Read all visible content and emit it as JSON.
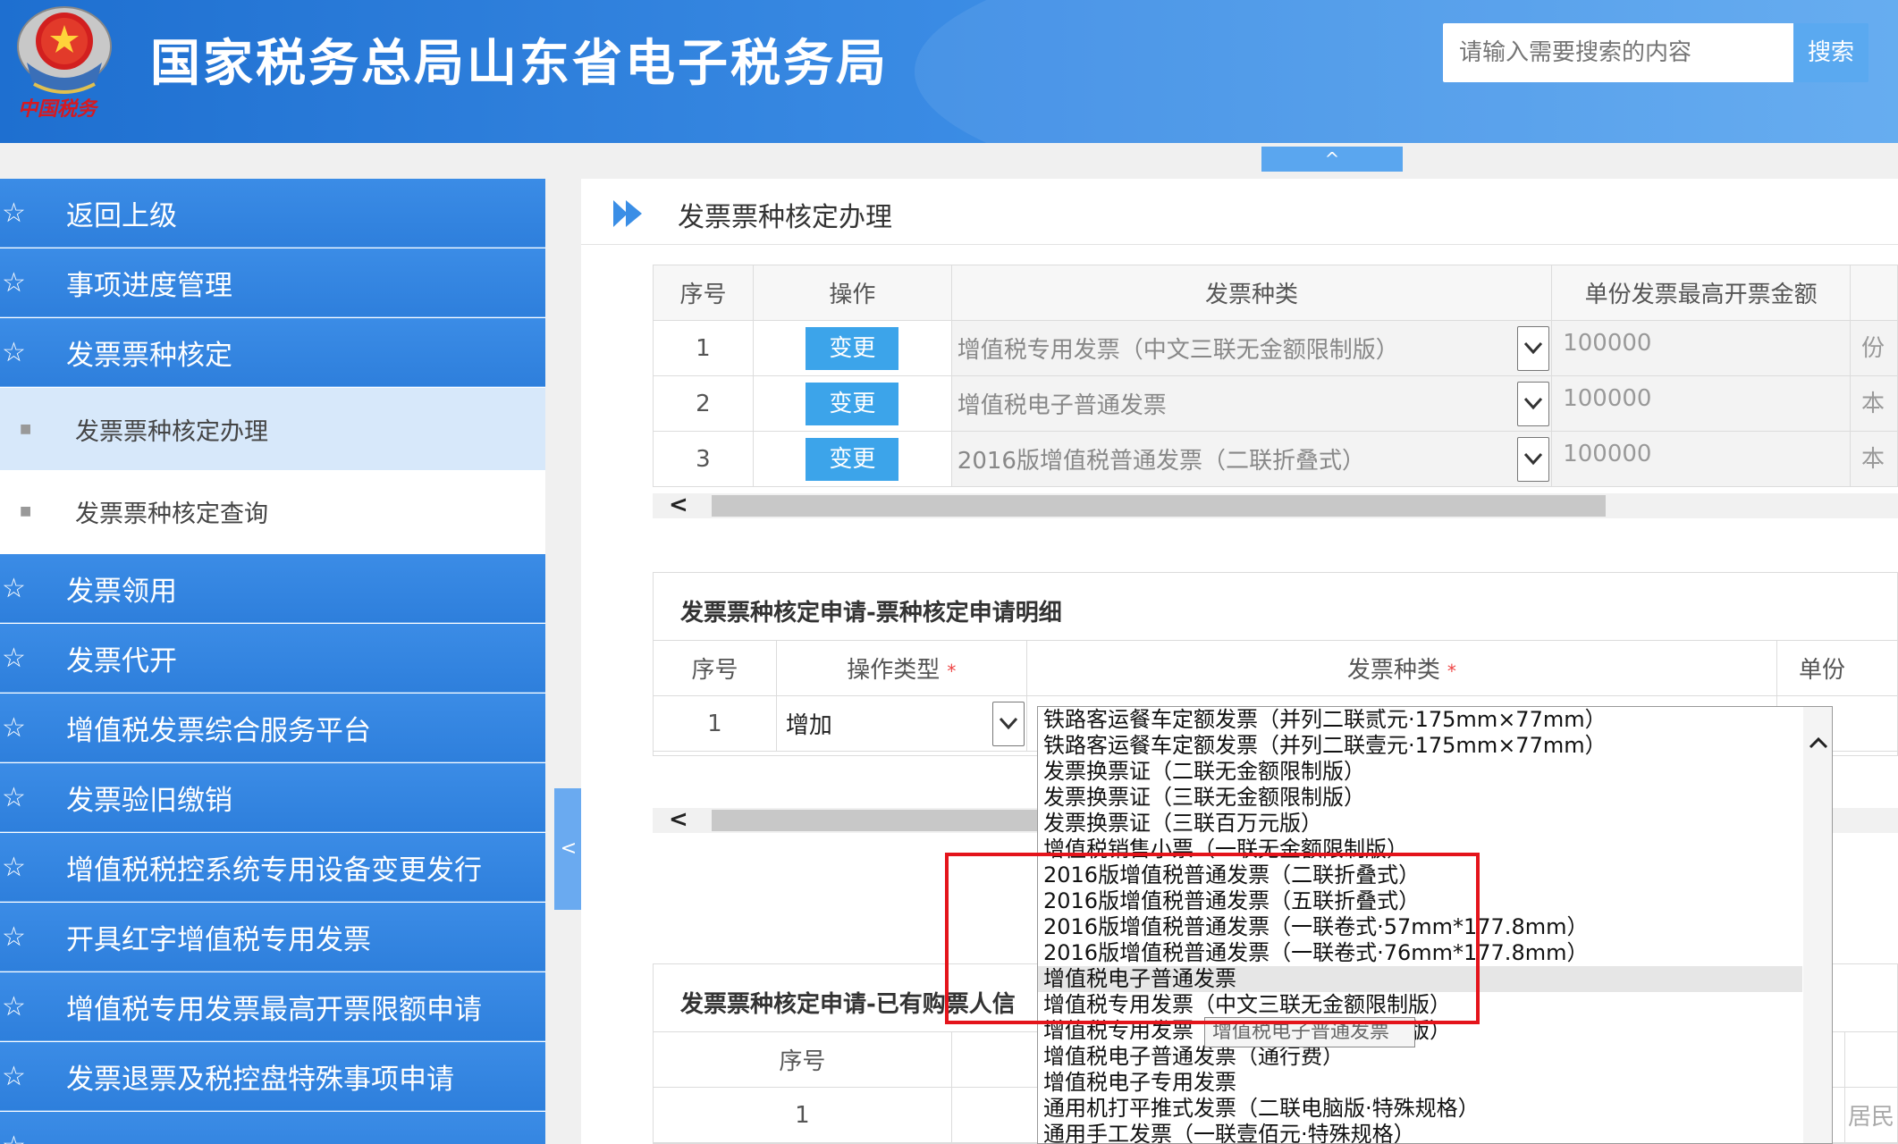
{
  "header": {
    "site_title": "国家税务总局山东省电子税务局",
    "emblem_caption": "中国税务",
    "search_placeholder": "请输入需要搜索的内容",
    "search_button": "搜索",
    "collapse_top": "^"
  },
  "sidebar": {
    "items": [
      {
        "label": "返回上级",
        "icon": "star-outline-icon"
      },
      {
        "label": "事项进度管理",
        "icon": "star-outline-icon"
      },
      {
        "label": "发票票种核定",
        "icon": "star-outline-icon"
      }
    ],
    "sub_items": [
      {
        "label": "发票票种核定办理",
        "active": true
      },
      {
        "label": "发票票种核定查询",
        "active": false
      }
    ],
    "items_after": [
      {
        "label": "发票领用"
      },
      {
        "label": "发票代开"
      },
      {
        "label": "增值税发票综合服务平台"
      },
      {
        "label": "发票验旧缴销"
      },
      {
        "label": "增值税税控系统专用设备变更发行"
      },
      {
        "label": "开具红字增值税专用发票"
      },
      {
        "label": "增值税专用发票最高开票限额申请"
      },
      {
        "label": "发票退票及税控盘特殊事项申请"
      }
    ],
    "toggle": "<"
  },
  "main": {
    "page_title": "发票票种核定办理",
    "table1": {
      "headers": [
        "序号",
        "操作",
        "发票种类",
        "单份发票最高开票金额"
      ],
      "rows": [
        {
          "no": "1",
          "action": "变更",
          "type": "增值税专用发票（中文三联无金额限制版）",
          "max": "100000",
          "unit": "份"
        },
        {
          "no": "2",
          "action": "变更",
          "type": "增值税电子普通发票",
          "max": "100000",
          "unit": "本"
        },
        {
          "no": "3",
          "action": "变更",
          "type": "2016版增值税普通发票（二联折叠式）",
          "max": "100000",
          "unit": "本"
        }
      ]
    },
    "section2": {
      "title": "发票票种核定申请-票种核定申请明细",
      "headers": [
        "序号",
        "操作类型",
        "发票种类",
        "单份"
      ],
      "required_mark": "*",
      "row": {
        "no": "1",
        "op_type": "增加"
      }
    },
    "section3": {
      "title": "发票票种核定申请-已有购票人信",
      "headers": [
        "序号"
      ],
      "row": {
        "no": "1",
        "extra": "居民"
      }
    },
    "scroll_left": "<"
  },
  "dropdown": {
    "options": [
      "铁路客运餐车定额发票（并列二联贰元·175mm×77mm）",
      "铁路客运餐车定额发票（并列二联壹元·175mm×77mm）",
      "发票换票证（二联无金额限制版）",
      "发票换票证（三联无金额限制版）",
      "发票换票证（三联百万元版）",
      "增值税销售小票（一联无金额限制版）",
      "2016版增值税普通发票（二联折叠式）",
      "2016版增值税普通发票（五联折叠式）",
      "2016版增值税普通发票（一联卷式·57mm*177.8mm）",
      "2016版增值税普通发票（一联卷式·76mm*177.8mm）",
      "增值税电子普通发票",
      "增值税专用发票（中文三联无金额限制版）",
      "增值税专用发票（中文二联无金额限制版）",
      "增值税电子普通发票（通行费）",
      "增值税电子专用发票",
      "通用机打平推式发票（二联电脑版·特殊规格）",
      "通用手工发票（一联壹佰元·特殊规格）"
    ],
    "highlighted_index": 10,
    "tooltip": "增值税电子普通发票",
    "scroll_up": "^"
  },
  "colors": {
    "header_blue": "#1e6fd0",
    "nav_blue": "#2e7fdc",
    "button_blue": "#3ca4ea",
    "highlight_red": "#e4141b"
  }
}
